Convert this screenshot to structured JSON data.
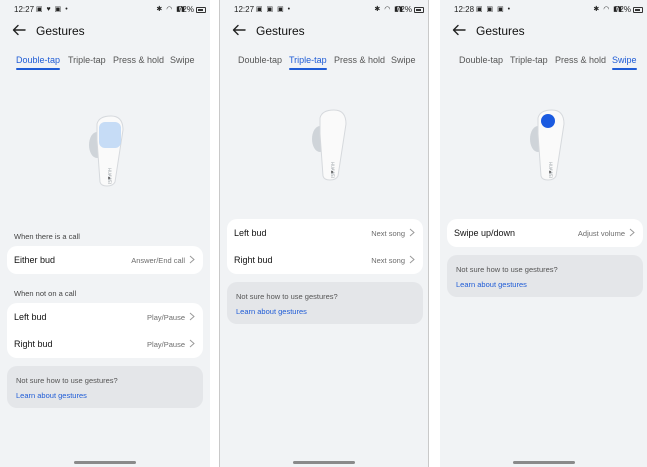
{
  "phones": [
    {
      "status": {
        "time": "12:27",
        "battery": "72%"
      },
      "title": "Gestures",
      "tabs": [
        {
          "label": "Double-tap",
          "active": true
        },
        {
          "label": "Triple-tap",
          "active": false
        },
        {
          "label": "Press & hold",
          "active": false
        },
        {
          "label": "Swipe",
          "active": false
        }
      ],
      "sections": [
        {
          "label": "When there is a call",
          "rows": [
            {
              "label": "Either bud",
              "value": "Answer/End call"
            }
          ]
        },
        {
          "label": "When not on a call",
          "rows": [
            {
              "label": "Left bud",
              "value": "Play/Pause"
            },
            {
              "label": "Right bud",
              "value": "Play/Pause"
            }
          ]
        }
      ],
      "help": {
        "text": "Not sure how to use gestures?",
        "link": "Learn about gestures"
      }
    },
    {
      "status": {
        "time": "12:27",
        "battery": "72%"
      },
      "title": "Gestures",
      "tabs": [
        {
          "label": "Double-tap",
          "active": false
        },
        {
          "label": "Triple-tap",
          "active": true
        },
        {
          "label": "Press & hold",
          "active": false
        },
        {
          "label": "Swipe",
          "active": false
        }
      ],
      "rows": [
        {
          "label": "Left bud",
          "value": "Next song"
        },
        {
          "label": "Right bud",
          "value": "Next song"
        }
      ],
      "help": {
        "text": "Not sure how to use gestures?",
        "link": "Learn about gestures"
      }
    },
    {
      "status": {
        "time": "12:28",
        "battery": "72%"
      },
      "title": "Gestures",
      "tabs": [
        {
          "label": "Double-tap",
          "active": false
        },
        {
          "label": "Triple-tap",
          "active": false
        },
        {
          "label": "Press & hold",
          "active": false
        },
        {
          "label": "Swipe",
          "active": true
        }
      ],
      "rows": [
        {
          "label": "Swipe up/down",
          "value": "Adjust volume"
        }
      ],
      "help": {
        "text": "Not sure how to use gestures?",
        "link": "Learn about gestures"
      }
    }
  ],
  "earbud_brand": "HUAWEI",
  "colors": {
    "accent": "#1f5cd6",
    "background": "#f1f3f5",
    "card": "#ffffff",
    "help_card": "#e4e6e9",
    "gesture_highlight": "#1a5ae0"
  },
  "icons": [
    "back-arrow-icon",
    "chevron-right-icon",
    "wifi-icon",
    "battery-icon",
    "bluetooth-icon"
  ]
}
